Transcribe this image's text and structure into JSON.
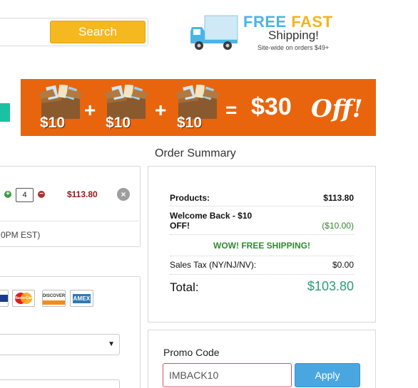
{
  "header": {
    "search_button": "Search",
    "shipping": {
      "line1_free": "FREE",
      "line1_fast": "FAST",
      "line2": "Shipping!",
      "line3": "Site-wide on orders $49+"
    }
  },
  "banner": {
    "items": [
      "$10",
      "$10",
      "$10"
    ],
    "plus": "+",
    "equals": "=",
    "total": "$30",
    "off": "Off!"
  },
  "summary_title": "Order Summary",
  "cart": {
    "quantity": "4",
    "price": "$113.80",
    "note": "0PM EST)"
  },
  "payment": {
    "cards": [
      "visa-card-icon",
      "mastercard-icon",
      "discover-card-icon",
      "amex-card-icon"
    ],
    "card_labels": {
      "mastercard": "MasterCard",
      "discover": "DISCOVER",
      "amex": "AMEX"
    },
    "select_caret": "▼"
  },
  "order_summary": {
    "products_label": "Products:",
    "products_value": "$113.80",
    "welcome_label": "Welcome Back - $10 OFF!",
    "welcome_value": "($10.00)",
    "shipping_label": "WOW! FREE SHIPPING!",
    "tax_label": "Sales Tax (NY/NJ/NV):",
    "tax_value": "$0.00",
    "total_label": "Total:",
    "total_value": "$103.80"
  },
  "promo": {
    "label": "Promo Code",
    "value": "IMBACK10",
    "apply_label": "Apply"
  },
  "colors": {
    "search_button": "#f5b81f",
    "banner": "#e8650d",
    "apply_button": "#4aa6e0",
    "total_value": "#2a9d74",
    "free_shipping": "#2e8b2e",
    "price": "#8b1b1b"
  }
}
